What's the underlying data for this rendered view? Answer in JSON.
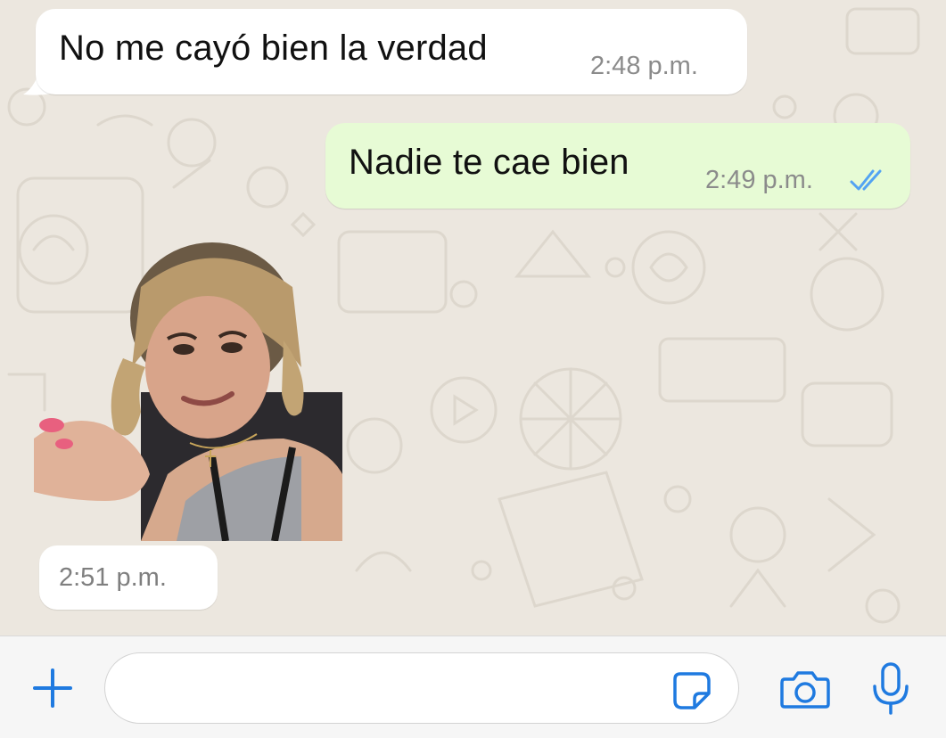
{
  "messages": [
    {
      "direction": "incoming",
      "text": "No me cayó bien la verdad",
      "time": "2:48 p.m."
    },
    {
      "direction": "outgoing",
      "text": "Nadie te cae bien",
      "time": "2:49 p.m.",
      "status": "read",
      "status_icon": "double-check-icon"
    },
    {
      "direction": "incoming",
      "type": "sticker",
      "sticker_desc": "sticker-image",
      "time": "2:51 p.m."
    }
  ],
  "input": {
    "placeholder": "",
    "value": "",
    "left_icon": "plus-icon",
    "inner_icon": "sticker-icon",
    "right_icons": [
      "camera-icon",
      "microphone-icon"
    ]
  },
  "colors": {
    "chat_background": "#ece7df",
    "incoming_bubble": "#ffffff",
    "outgoing_bubble": "#e7fbd5",
    "accent": "#1f7ae0",
    "read_ticks": "#53a3f2"
  }
}
